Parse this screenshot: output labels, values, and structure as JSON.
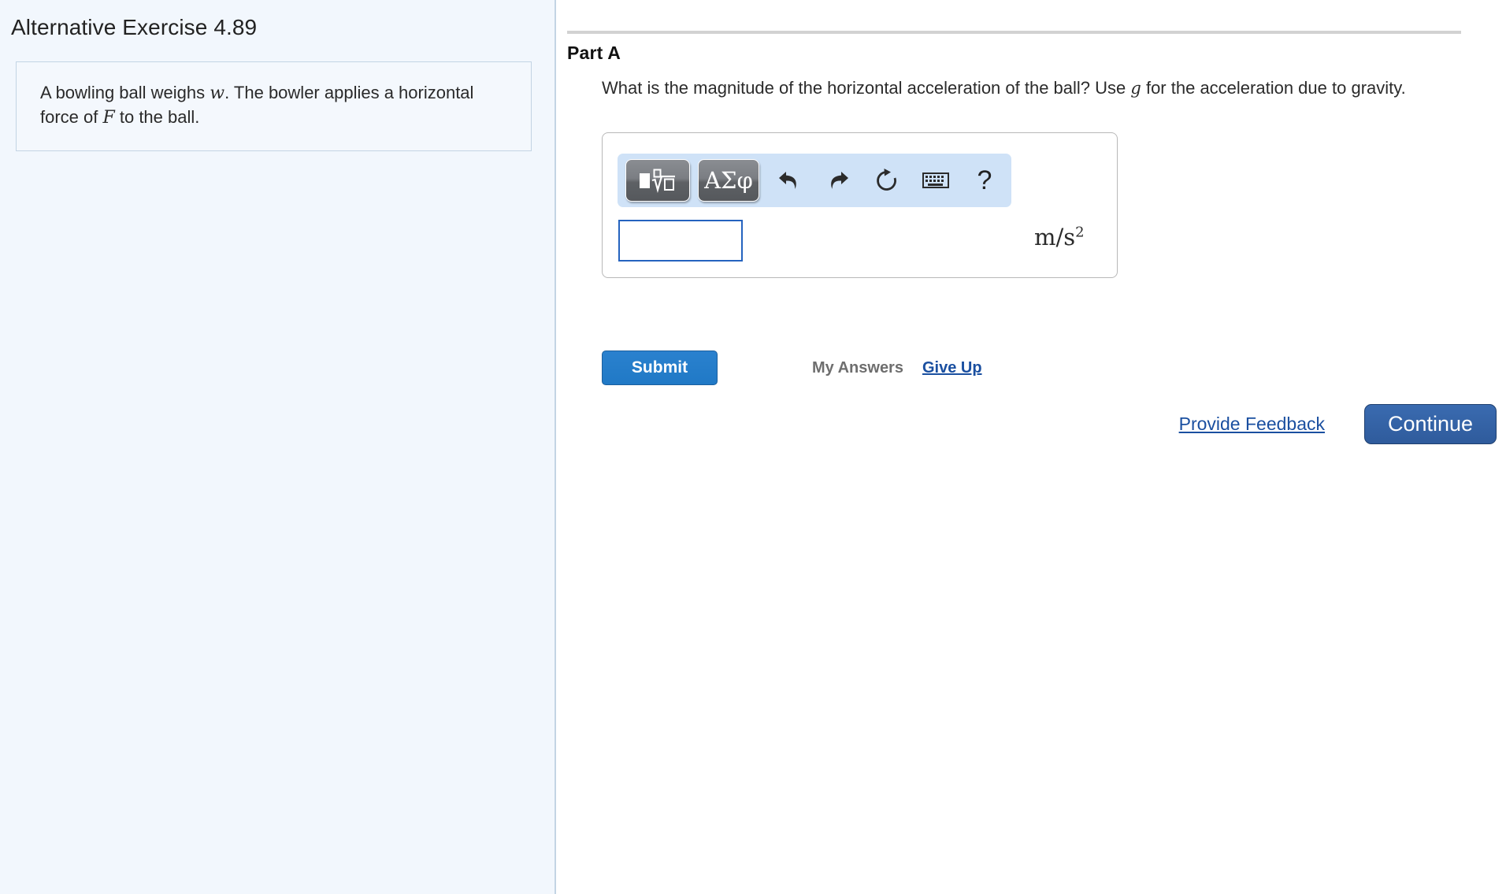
{
  "left_panel": {
    "exercise_title": "Alternative Exercise 4.89",
    "problem_statement": {
      "segment_1": "A bowling ball weighs ",
      "var_1": "w",
      "segment_2": ". The bowler applies a horizontal force of ",
      "var_2": "F",
      "segment_3": " to the ball."
    }
  },
  "right_panel": {
    "part_label": "Part A",
    "question": {
      "segment_1": "What is the magnitude of the horizontal acceleration of the ball? Use ",
      "var_1": "g",
      "segment_2": " for the acceleration due to gravity."
    },
    "answer_widget": {
      "toolbar": {
        "template_button_label": "□√□",
        "greek_button_label": "ΑΣφ",
        "undo_icon": "undo-arrow-icon",
        "redo_icon": "redo-arrow-icon",
        "reset_icon": "reset-circular-arrow-icon",
        "keyboard_icon": "keyboard-icon",
        "help_label": "?"
      },
      "input_value": "",
      "input_placeholder": "",
      "units": "m/s",
      "units_exponent": "2"
    },
    "actions": {
      "submit_label": "Submit",
      "my_answers_label": "My Answers",
      "give_up_label": "Give Up"
    },
    "footer": {
      "provide_feedback_label": "Provide Feedback",
      "continue_label": "Continue"
    }
  },
  "colors": {
    "left_panel_bg": "#f2f7fd",
    "divider": "#c3d4e4",
    "toolbar_bg": "#cfe2f7",
    "submit_blue": "#2079c6",
    "continue_blue": "#2f5b9c",
    "link_blue": "#1a4fa0",
    "input_border_blue": "#2563bf"
  }
}
